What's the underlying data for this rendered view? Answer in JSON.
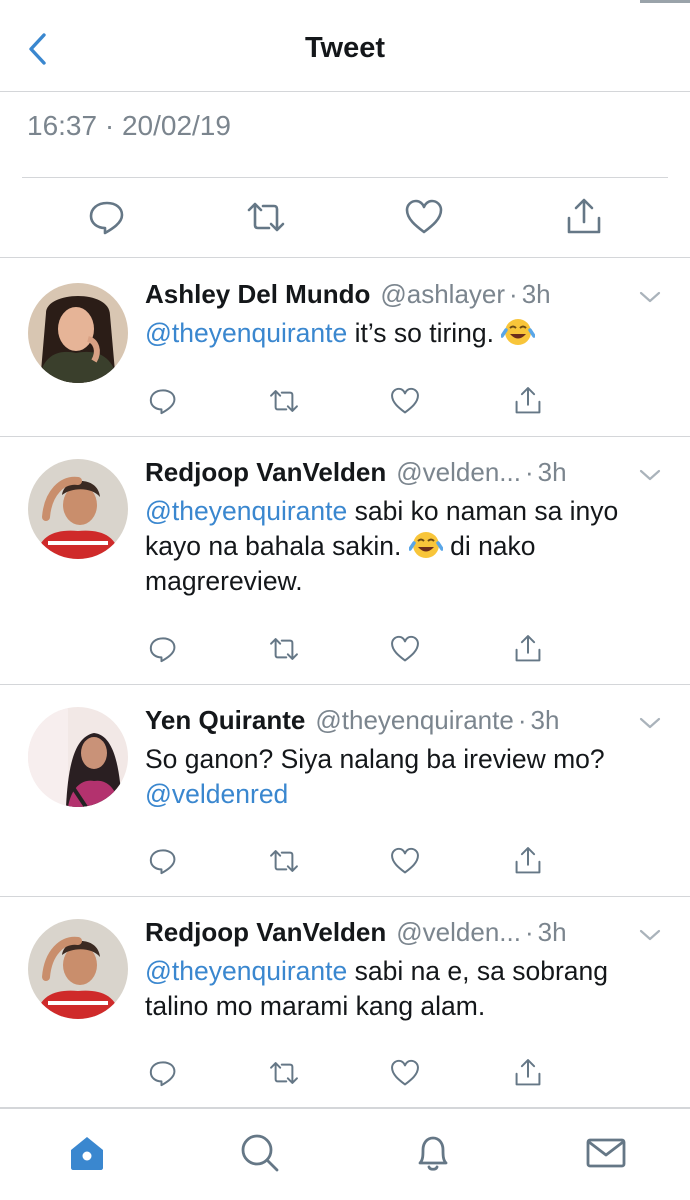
{
  "header": {
    "title": "Tweet"
  },
  "tweet_meta": {
    "timestamp": "16:37 · 20/02/19"
  },
  "icons": {
    "back": "chevron-left-icon",
    "reply": "speech-bubble-icon",
    "retweet": "retweet-icon",
    "like": "heart-icon",
    "share": "share-icon",
    "menu": "chevron-down-icon",
    "tab_home": "home-icon",
    "tab_search": "search-icon",
    "tab_notifications": "bell-icon",
    "tab_messages": "mail-icon"
  },
  "colors": {
    "accent": "#3a87cf",
    "muted": "#7b858e",
    "icon": "#657786",
    "divider": "#d4d6d9"
  },
  "replies": [
    {
      "name": "Ashley Del Mundo",
      "handle": "@ashlayer",
      "separator": "·",
      "time": "3h",
      "mention": "@theyenquirante",
      "text_1": " it’s so tiring. ",
      "emoji": "face-with-tears-of-joy",
      "text_2": ""
    },
    {
      "name": "Redjoop VanVelden",
      "handle": "@velden...",
      "separator": "·",
      "time": "3h",
      "mention": "@theyenquirante",
      "text_1": " sabi ko naman sa inyo kayo na bahala sakin. ",
      "emoji": "face-with-tears-of-joy",
      "text_2": " di nako magrereview."
    },
    {
      "name": "Yen Quirante",
      "handle": "@theyenquirante",
      "separator": "·",
      "time": "3h",
      "text_1": "So ganon? Siya nalang ba ireview mo? ",
      "mention": "@veldenred"
    },
    {
      "name": "Redjoop VanVelden",
      "handle": "@velden...",
      "separator": "·",
      "time": "3h",
      "mention": "@theyenquirante",
      "text_1": " sabi na e, sa sobrang talino mo marami kang alam."
    }
  ]
}
